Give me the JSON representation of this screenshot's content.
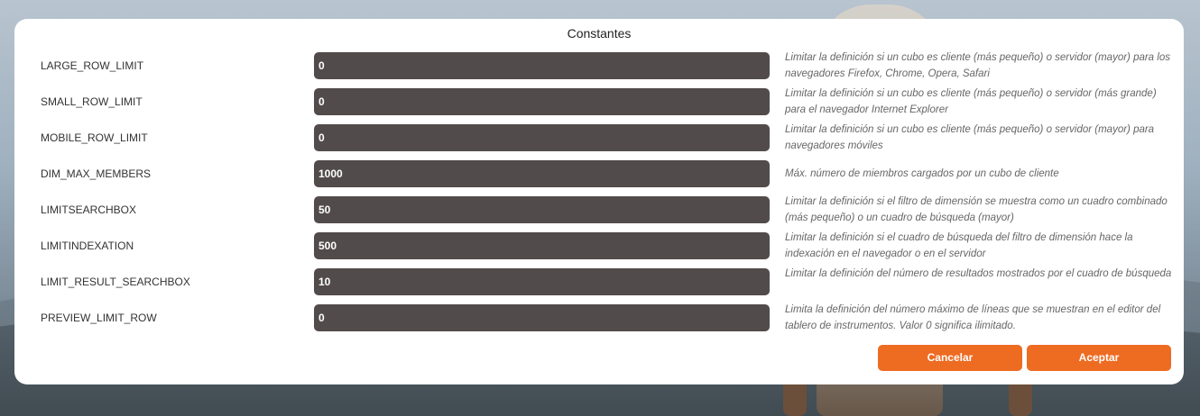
{
  "dialog": {
    "title": "Constantes",
    "rows": [
      {
        "name": "LARGE_ROW_LIMIT",
        "value": "0",
        "description": "Limitar la definición si un cubo es cliente (más pequeño) o servidor (mayor) para los navegadores Firefox, Chrome, Opera, Safari"
      },
      {
        "name": "SMALL_ROW_LIMIT",
        "value": "0",
        "description": "Limitar la definición si un cubo es cliente (más pequeño) o servidor (más grande) para el navegador Internet Explorer"
      },
      {
        "name": "MOBILE_ROW_LIMIT",
        "value": "0",
        "description": "Limitar la definición si un cubo es cliente (más pequeño) o servidor (mayor) para navegadores móviles"
      },
      {
        "name": "DIM_MAX_MEMBERS",
        "value": "1000",
        "description": "Máx. número de miembros cargados por un cubo de cliente"
      },
      {
        "name": "LIMITSEARCHBOX",
        "value": "50",
        "description": "Limitar la definición si el filtro de dimensión se muestra como un cuadro combinado (más pequeño) o un cuadro de búsqueda (mayor)"
      },
      {
        "name": "LIMITINDEXATION",
        "value": "500",
        "description": "Limitar la definición si el cuadro de búsqueda del filtro de dimensión hace la indexación en el navegador o en el servidor"
      },
      {
        "name": "LIMIT_RESULT_SEARCHBOX",
        "value": "10",
        "description": "Limitar la definición del número de resultados mostrados por el cuadro de búsqueda"
      },
      {
        "name": "PREVIEW_LIMIT_ROW",
        "value": "0",
        "description": "Limita la definición del número máximo de líneas que se muestran en el editor del tablero de instrumentos. Valor 0 significa ilimitado."
      }
    ],
    "buttons": {
      "cancel": "Cancelar",
      "accept": "Aceptar"
    }
  },
  "colors": {
    "accent": "#ee6b22",
    "input_bg": "#524b4b"
  }
}
